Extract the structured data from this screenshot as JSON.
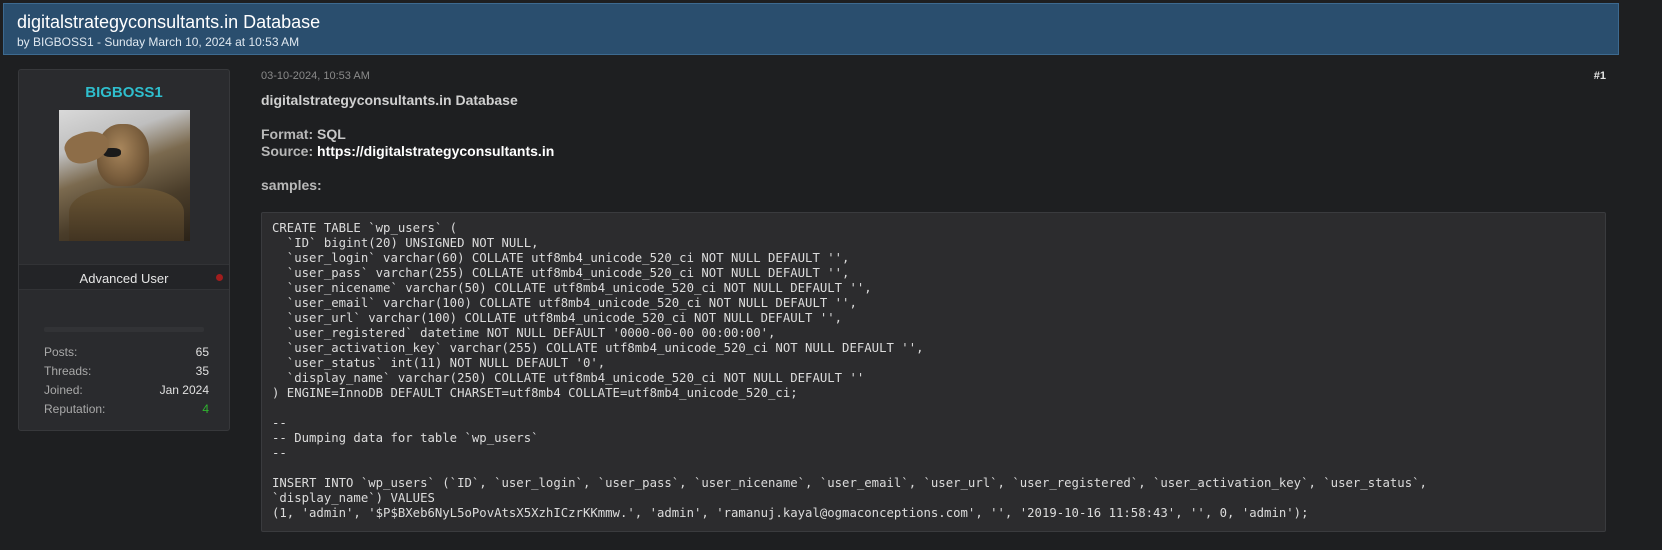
{
  "thread": {
    "title": "digitalstrategyconsultants.in Database",
    "byline": "by BIGBOSS1 - Sunday March 10, 2024 at 10:53 AM"
  },
  "user": {
    "username": "BIGBOSS1",
    "avatar_icon": "avatar-soldier-saluting",
    "title": "Advanced User",
    "status_color": "#a11d1d",
    "stats": [
      {
        "label": "Posts:",
        "value": "65"
      },
      {
        "label": "Threads:",
        "value": "35"
      },
      {
        "label": "Joined:",
        "value": "Jan 2024"
      },
      {
        "label": "Reputation:",
        "value": "4"
      }
    ]
  },
  "post": {
    "date": "03-10-2024, 10:53 AM",
    "number": "#1",
    "title": "digitalstrategyconsultants.in Database",
    "format_label": "Format:",
    "format_value": " SQL",
    "source_label": "Source:",
    "source_value": "https://digitalstrategyconsultants.in",
    "samples_label": "samples:",
    "code_lines": [
      "CREATE TABLE `wp_users` (",
      "  `ID` bigint(20) UNSIGNED NOT NULL,",
      "  `user_login` varchar(60) COLLATE utf8mb4_unicode_520_ci NOT NULL DEFAULT '',",
      "  `user_pass` varchar(255) COLLATE utf8mb4_unicode_520_ci NOT NULL DEFAULT '',",
      "  `user_nicename` varchar(50) COLLATE utf8mb4_unicode_520_ci NOT NULL DEFAULT '',",
      "  `user_email` varchar(100) COLLATE utf8mb4_unicode_520_ci NOT NULL DEFAULT '',",
      "  `user_url` varchar(100) COLLATE utf8mb4_unicode_520_ci NOT NULL DEFAULT '',",
      "  `user_registered` datetime NOT NULL DEFAULT '0000-00-00 00:00:00',",
      "  `user_activation_key` varchar(255) COLLATE utf8mb4_unicode_520_ci NOT NULL DEFAULT '',",
      "  `user_status` int(11) NOT NULL DEFAULT '0',",
      "  `display_name` varchar(250) COLLATE utf8mb4_unicode_520_ci NOT NULL DEFAULT ''",
      ") ENGINE=InnoDB DEFAULT CHARSET=utf8mb4 COLLATE=utf8mb4_unicode_520_ci;",
      "",
      "--",
      "-- Dumping data for table `wp_users`",
      "--",
      "",
      "INSERT INTO `wp_users` (`ID`, `user_login`, `user_pass`, `user_nicename`, `user_email`, `user_url`, `user_registered`, `user_activation_key`, `user_status`,",
      "`display_name`) VALUES",
      "(1, 'admin', '$P$BXeb6NyL5oPovAtsX5XzhICzrKKmmw.', 'admin', 'ramanuj.kayal@ogmaconceptions.com', '', '2019-10-16 11:58:43', '', 0, 'admin');"
    ]
  }
}
